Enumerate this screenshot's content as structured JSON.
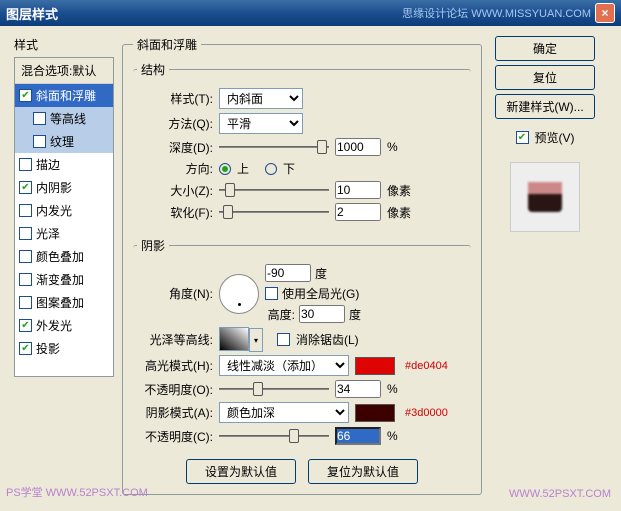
{
  "titlebar": {
    "title": "图层样式",
    "brand": "思缘设计论坛  WWW.MISSYUAN.COM"
  },
  "left": {
    "section": "样式",
    "header": "混合选项:默认",
    "items": [
      {
        "label": "斜面和浮雕",
        "checked": true,
        "selected": true
      },
      {
        "label": "等高线",
        "checked": false,
        "sub": true,
        "selected2": true
      },
      {
        "label": "纹理",
        "checked": false,
        "sub": true,
        "selected2": true
      },
      {
        "label": "描边",
        "checked": false
      },
      {
        "label": "内阴影",
        "checked": true
      },
      {
        "label": "内发光",
        "checked": false
      },
      {
        "label": "光泽",
        "checked": false
      },
      {
        "label": "颜色叠加",
        "checked": false
      },
      {
        "label": "渐变叠加",
        "checked": false
      },
      {
        "label": "图案叠加",
        "checked": false
      },
      {
        "label": "外发光",
        "checked": true
      },
      {
        "label": "投影",
        "checked": true
      }
    ]
  },
  "mid": {
    "group_title": "斜面和浮雕",
    "structure": {
      "legend": "结构",
      "style_lbl": "样式(T):",
      "style_val": "内斜面",
      "tech_lbl": "方法(Q):",
      "tech_val": "平滑",
      "depth_lbl": "深度(D):",
      "depth_val": "1000",
      "pct": "%",
      "dir_lbl": "方向:",
      "up": "上",
      "down": "下",
      "size_lbl": "大小(Z):",
      "size_val": "10",
      "px": "像素",
      "soften_lbl": "软化(F):",
      "soften_val": "2"
    },
    "shading": {
      "legend": "阴影",
      "angle_lbl": "角度(N):",
      "angle_val": "-90",
      "deg": "度",
      "global_lbl": "使用全局光(G)",
      "alt_lbl": "高度:",
      "alt_val": "30",
      "gloss_lbl": "光泽等高线:",
      "aa_lbl": "消除锯齿(L)",
      "hmode_lbl": "高光模式(H):",
      "hmode_val": "线性减淡（添加）",
      "hcolor": "#de0404",
      "hhex": "#de0404",
      "hop_lbl": "不透明度(O):",
      "hop_val": "34",
      "smode_lbl": "阴影模式(A):",
      "smode_val": "颜色加深",
      "scolor": "#3d0000",
      "shex": "#3d0000",
      "sop_lbl": "不透明度(C):",
      "sop_val": "66"
    },
    "defaults_btn": "设置为默认值",
    "reset_btn": "复位为默认值"
  },
  "right": {
    "ok": "确定",
    "cancel": "复位",
    "newstyle": "新建样式(W)...",
    "preview_lbl": "预览(V)"
  },
  "watermark_left": "PS学堂   WWW.52PSXT.COM",
  "watermark_right": "WWW.52PSXT.COM"
}
